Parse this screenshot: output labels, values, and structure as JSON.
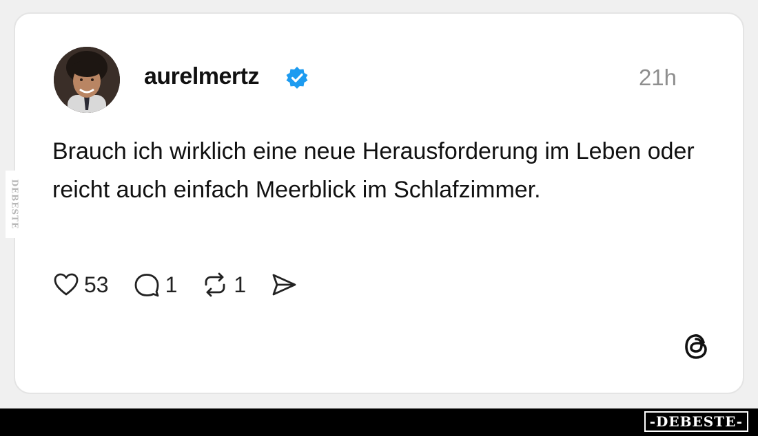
{
  "post": {
    "username": "aurelmertz",
    "timestamp": "21h",
    "text": "Brauch ich wirklich eine neue Herausforderung im Leben oder reicht auch einfach Meerblick im Schlafzimmer.",
    "likes": "53",
    "replies": "1",
    "reposts": "1"
  },
  "icons": {
    "verified": "verified-badge-icon",
    "like": "heart-icon",
    "reply": "speech-bubble-icon",
    "repost": "repost-icon",
    "share": "send-icon",
    "platform": "threads-logo-icon"
  },
  "watermark": {
    "side": "DEBESTE",
    "brand": "-DEBESTE-"
  },
  "colors": {
    "verified": "#1d9bf0",
    "background": "#f0f0f0",
    "card": "#ffffff",
    "time": "#8e8e8e"
  }
}
